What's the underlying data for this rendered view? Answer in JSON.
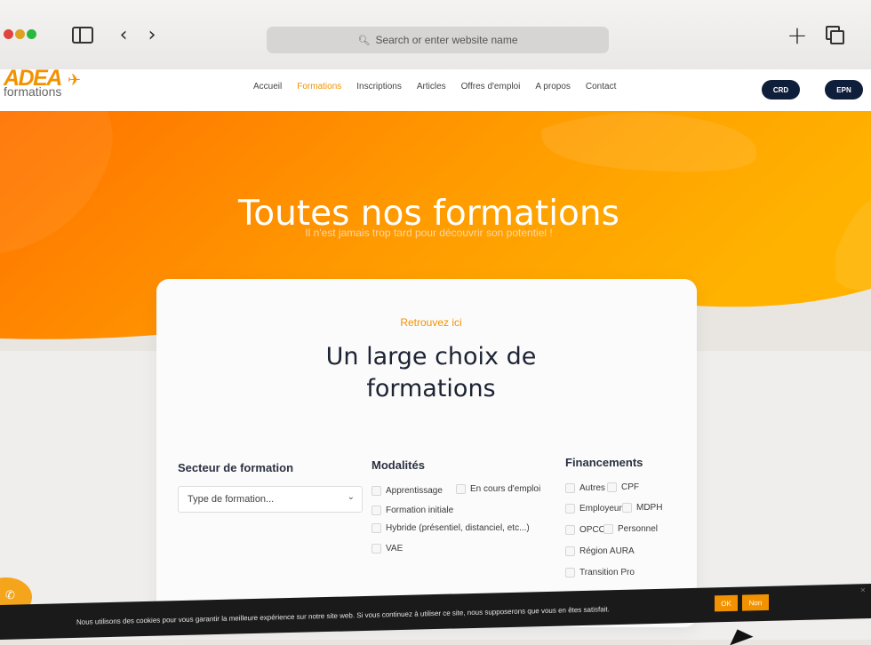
{
  "browser": {
    "address_placeholder": "Search or enter website name"
  },
  "header": {
    "logo_text": "ADEA",
    "logo_subtext": "formations",
    "nav": [
      {
        "label": "Accueil"
      },
      {
        "label": "Formations"
      },
      {
        "label": "Inscriptions"
      },
      {
        "label": "Articles"
      },
      {
        "label": "Offres d'emploi"
      },
      {
        "label": "A propos"
      },
      {
        "label": "Contact"
      }
    ],
    "active_nav": "Formations",
    "crd_label": "CRD",
    "epn_label": "EPN"
  },
  "hero": {
    "title": "Toutes nos formations",
    "subtitle": "Il n'est jamais trop tard pour découvrir son potentiel !"
  },
  "card": {
    "kicker": "Retrouvez ici",
    "title_line1": "Un large choix de",
    "title_line2": "formations",
    "secteur": {
      "heading": "Secteur de formation",
      "select_value": "Type de formation..."
    },
    "modalites": {
      "heading": "Modalités",
      "options": [
        "Apprentissage",
        "En cours d'emploi",
        "Formation initiale",
        "Hybride (présentiel, distanciel, etc...)",
        "VAE"
      ]
    },
    "financements": {
      "heading": "Financements",
      "options": [
        "Autres",
        "CPF",
        "Employeur",
        "MDPH",
        "OPCO",
        "Personnel",
        "Région AURA",
        "Transition Pro"
      ]
    }
  },
  "cookie": {
    "text": "Nous utilisons des cookies pour vous garantir la meilleure expérience sur notre site web. Si vous continuez à utiliser ce site, nous supposerons que vous en êtes satisfait.",
    "ok_label": "OK",
    "non_label": "Non",
    "close_label": "×"
  },
  "colors": {
    "brand_orange": "#f39200",
    "hero_gradient_start": "#ff7a00",
    "hero_gradient_end": "#ffb000",
    "navy": "#0f1e3a"
  }
}
